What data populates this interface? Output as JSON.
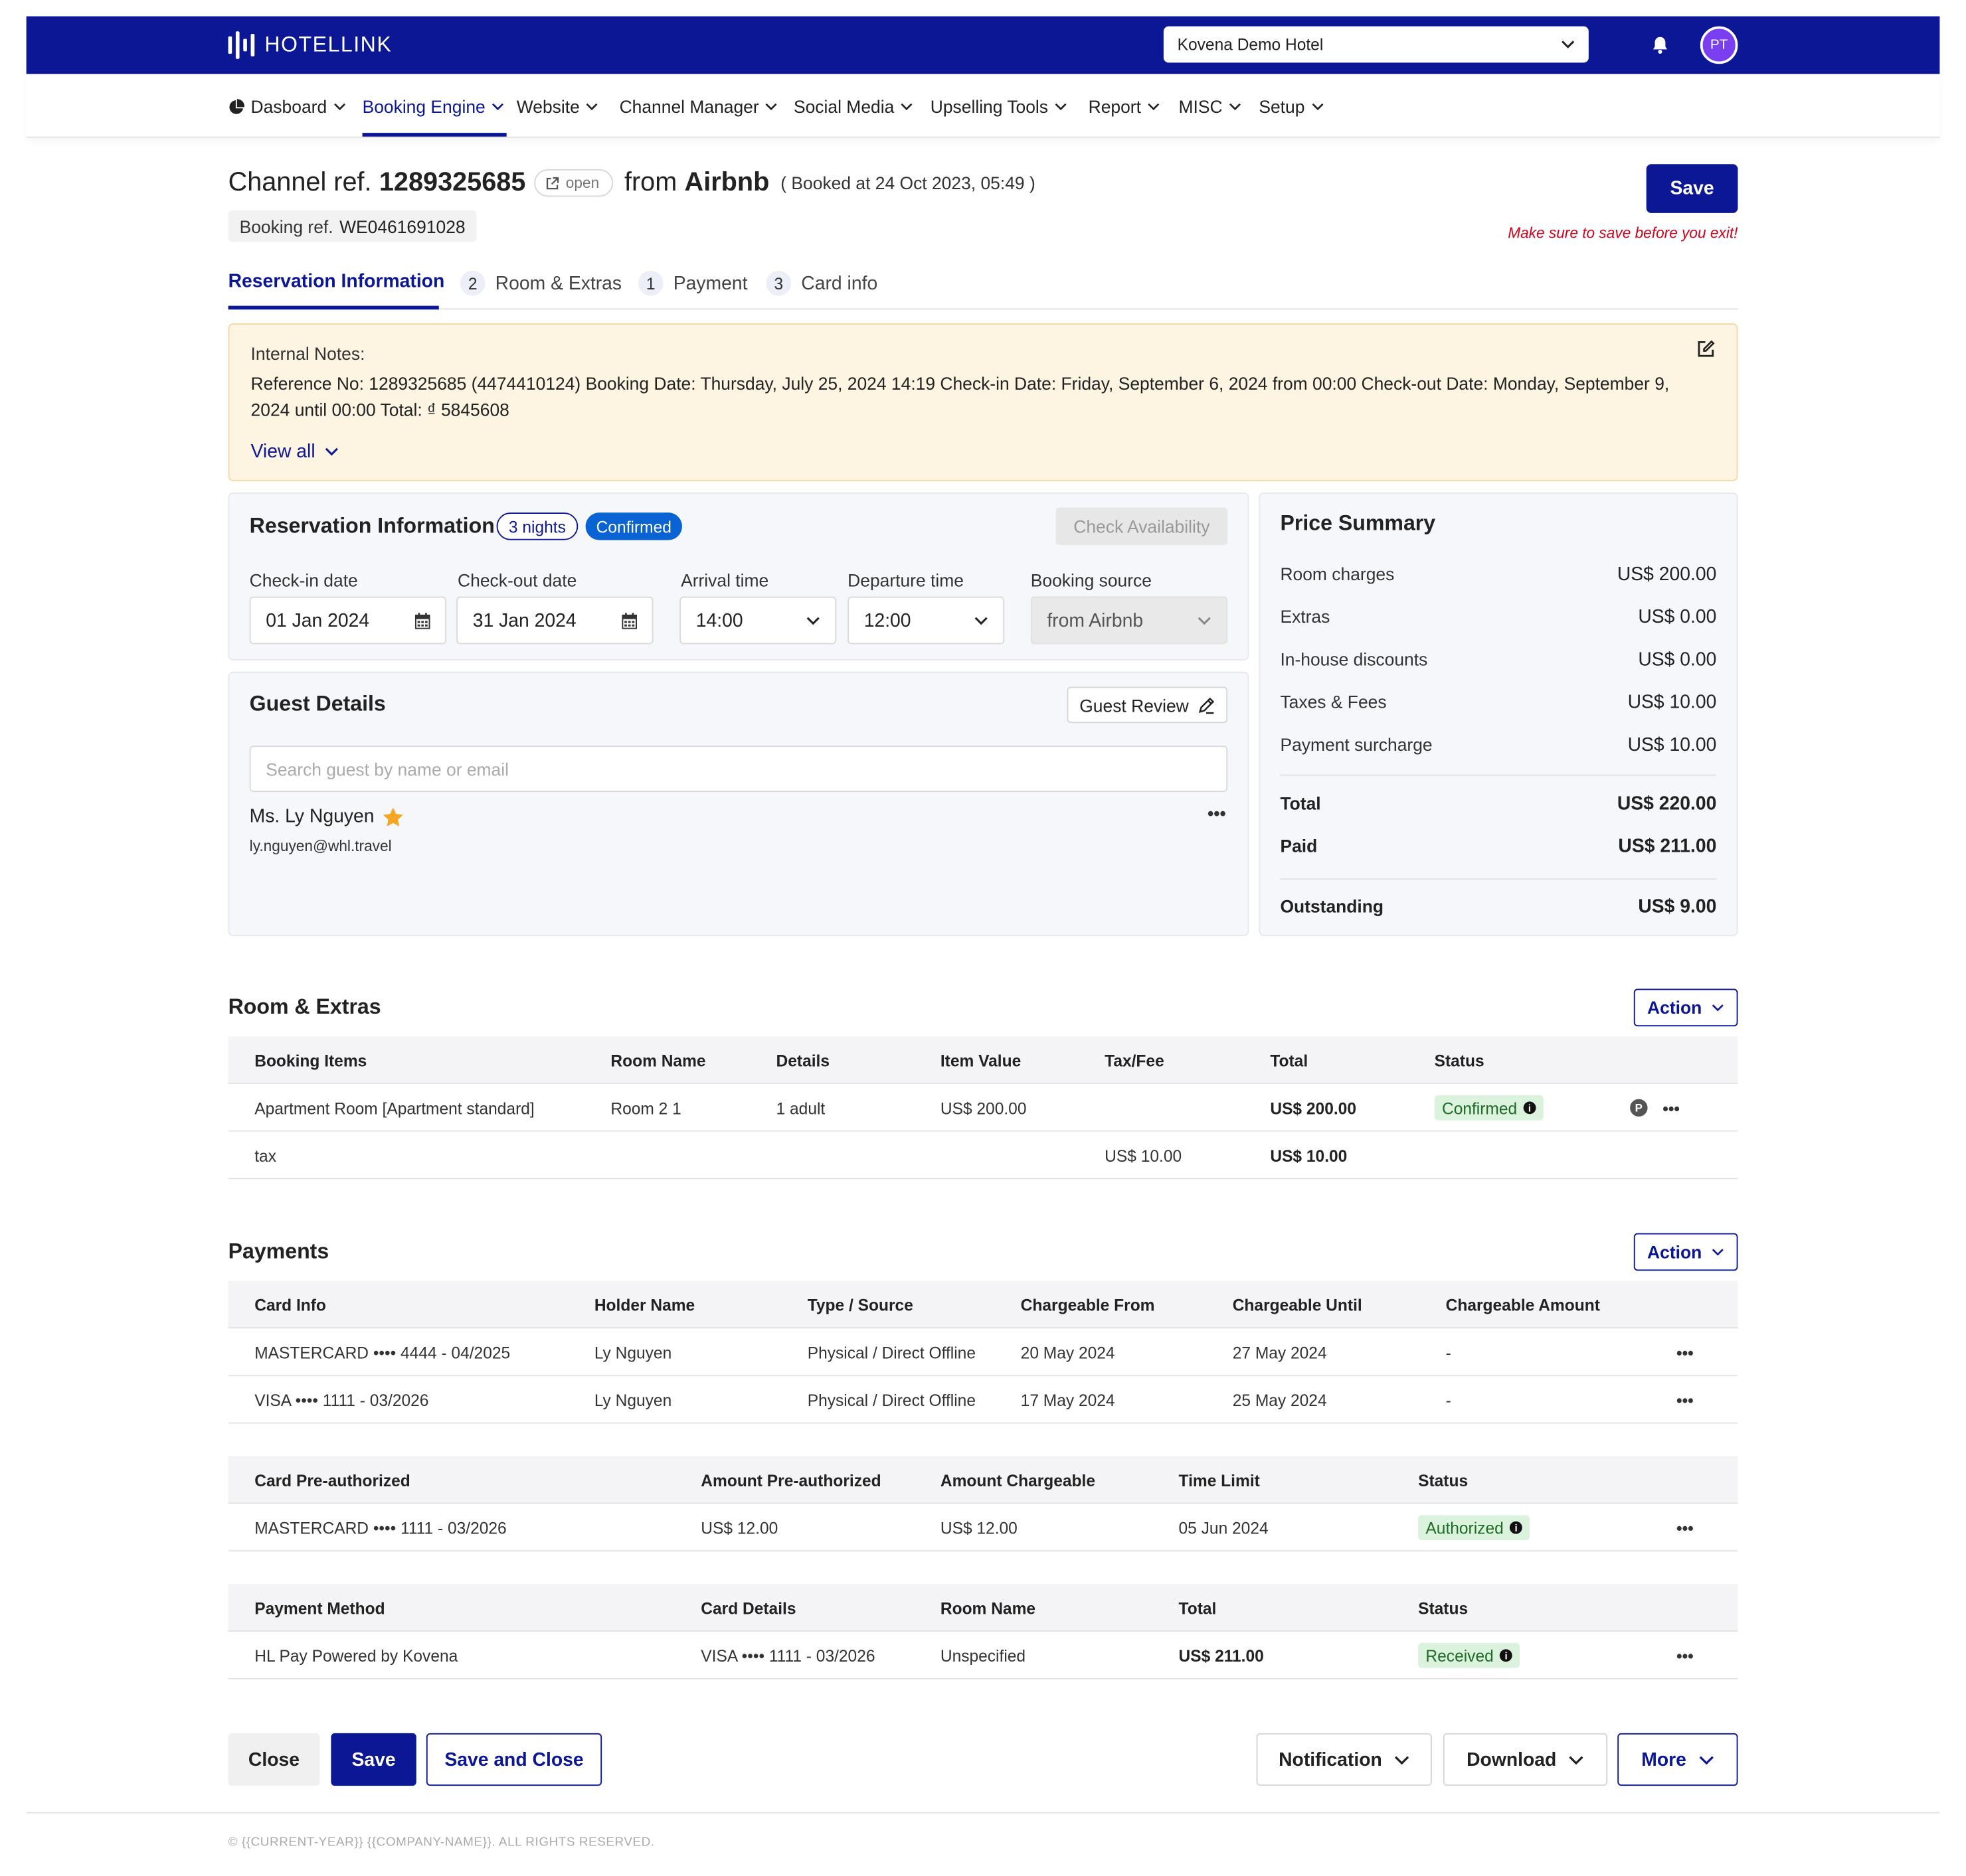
{
  "header": {
    "brand": "HOTELLINK",
    "hotel_select": "Kovena Demo Hotel",
    "avatar_initials": "PT",
    "brand_color": "#0c1796"
  },
  "nav": {
    "items": [
      {
        "label": "Dasboard",
        "icon": "pie-chart-icon"
      },
      {
        "label": "Booking Engine",
        "active": true
      },
      {
        "label": "Website"
      },
      {
        "label": "Channel Manager"
      },
      {
        "label": "Social Media"
      },
      {
        "label": "Upselling Tools"
      },
      {
        "label": "Report"
      },
      {
        "label": "MISC"
      },
      {
        "label": "Setup"
      }
    ]
  },
  "booking": {
    "channel_ref_label": "Channel ref.",
    "channel_ref": "1289325685",
    "open_label": "open",
    "from_label": "from",
    "source": "Airbnb",
    "booked_at": "( Booked at 24 Oct 2023, 05:49 )",
    "booking_ref_label": "Booking ref.",
    "booking_ref": "WE0461691028",
    "save_label": "Save",
    "save_warning": "Make sure to save before you exit!"
  },
  "tabs": [
    {
      "label": "Reservation Information",
      "num": "",
      "active": true
    },
    {
      "label": "Room & Extras",
      "num": "2"
    },
    {
      "label": "Payment",
      "num": "1"
    },
    {
      "label": "Card info",
      "num": "3"
    }
  ],
  "notes": {
    "label": "Internal Notes:",
    "text": "Reference No: 1289325685 (4474410124) Booking Date: Thursday, July 25, 2024 14:19 Check-in Date: Friday, September 6, 2024 from 00:00 Check-out Date: Monday, September 9, 2024 until 00:00 Total: ₫ 5845608",
    "view_all": "View all"
  },
  "reservation": {
    "title": "Reservation Information",
    "nights": "3 nights",
    "status": "Confirmed",
    "check_availability": "Check Availability",
    "checkin_label": "Check-in date",
    "checkin": "01 Jan 2024",
    "checkout_label": "Check-out date",
    "checkout": "31 Jan 2024",
    "arrival_label": "Arrival time",
    "arrival": "14:00",
    "departure_label": "Departure time",
    "departure": "12:00",
    "source_label": "Booking source",
    "source": "from Airbnb"
  },
  "guest": {
    "title": "Guest Details",
    "review_button": "Guest Review",
    "search_placeholder": "Search guest by name or email",
    "name": "Ms. Ly Nguyen",
    "email": "ly.nguyen@whl.travel"
  },
  "price_summary": {
    "title": "Price Summary",
    "rows": [
      {
        "label": "Room charges",
        "value": "US$ 200.00"
      },
      {
        "label": "Extras",
        "value": "US$ 0.00"
      },
      {
        "label": "In-house discounts",
        "value": "US$ 0.00"
      },
      {
        "label": "Taxes & Fees",
        "value": "US$ 10.00"
      },
      {
        "label": "Payment surcharge",
        "value": "US$ 10.00"
      }
    ],
    "total_label": "Total",
    "total": "US$ 220.00",
    "paid_label": "Paid",
    "paid": "US$ 211.00",
    "outstanding_label": "Outstanding",
    "outstanding": "US$ 9.00"
  },
  "room_extras": {
    "title": "Room & Extras",
    "action": "Action",
    "columns": [
      "Booking Items",
      "Room Name",
      "Details",
      "Item Value",
      "Tax/Fee",
      "Total",
      "Status"
    ],
    "rows": [
      {
        "item": "Apartment Room [Apartment standard]",
        "room": "Room 2 1",
        "details": "1 adult",
        "value": "US$ 200.00",
        "tax": "",
        "total": "US$ 200.00",
        "status": "Confirmed"
      },
      {
        "item": "tax",
        "room": "",
        "details": "",
        "value": "",
        "tax": "US$ 10.00",
        "total": "US$ 10.00",
        "status": ""
      }
    ]
  },
  "payments": {
    "title": "Payments",
    "action": "Action",
    "cards": {
      "columns": [
        "Card Info",
        "Holder Name",
        "Type / Source",
        "Chargeable From",
        "Chargeable Until",
        "Chargeable Amount"
      ],
      "rows": [
        {
          "card": "MASTERCARD •••• 4444 - 04/2025",
          "holder": "Ly Nguyen",
          "type": "Physical / Direct Offline",
          "from": "20 May 2024",
          "until": "27 May 2024",
          "amount": "-"
        },
        {
          "card": "VISA •••• 1111 - 03/2026",
          "holder": "Ly Nguyen",
          "type": "Physical / Direct Offline",
          "from": "17 May 2024",
          "until": "25 May 2024",
          "amount": "-"
        }
      ]
    },
    "preauth": {
      "columns": [
        "Card Pre-authorized",
        "Amount Pre-authorized",
        "Amount Chargeable",
        "Time Limit",
        "Status"
      ],
      "rows": [
        {
          "card": "MASTERCARD •••• 1111 - 03/2026",
          "amount": "US$ 12.00",
          "chargeable": "US$ 12.00",
          "limit": "05 Jun 2024",
          "status": "Authorized"
        }
      ]
    },
    "methods": {
      "columns": [
        "Payment Method",
        "Card Details",
        "Room Name",
        "Total",
        "Status"
      ],
      "rows": [
        {
          "method": "HL Pay Powered by Kovena",
          "card": "VISA •••• 1111 - 03/2026",
          "room": "Unspecified",
          "total": "US$ 211.00",
          "status": "Received"
        }
      ]
    }
  },
  "bottom": {
    "close": "Close",
    "save": "Save",
    "save_close": "Save and Close",
    "notification": "Notification",
    "download": "Download",
    "more": "More"
  },
  "footer": "© {{CURRENT-YEAR}} {{COMPANY-NAME}}. ALL RIGHTS RESERVED."
}
